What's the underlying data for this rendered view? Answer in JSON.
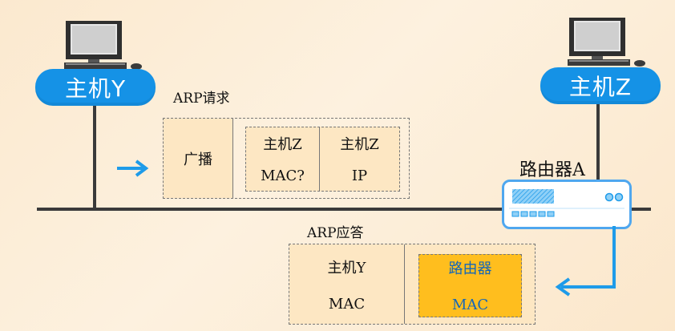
{
  "hosts": {
    "host_y": {
      "label": "主机Y"
    },
    "host_z": {
      "label": "主机Z"
    }
  },
  "arp_request": {
    "title": "ARP请求",
    "broadcast": "广播",
    "col1_line1": "主机Z",
    "col1_line2": "MAC?",
    "col2_line1": "主机Z",
    "col2_line2": "IP"
  },
  "router": {
    "label": "路由器A"
  },
  "arp_reply": {
    "title": "ARP应答",
    "col1_line1": "主机Y",
    "col1_line2": "MAC",
    "col2_line1": "路由器",
    "col2_line2": "MAC"
  },
  "colors": {
    "cloud_blue": "#1592e6",
    "arrow_blue": "#1e9be9",
    "highlight_orange": "#ffbe1e",
    "cell_fill": "#fde7c3"
  }
}
